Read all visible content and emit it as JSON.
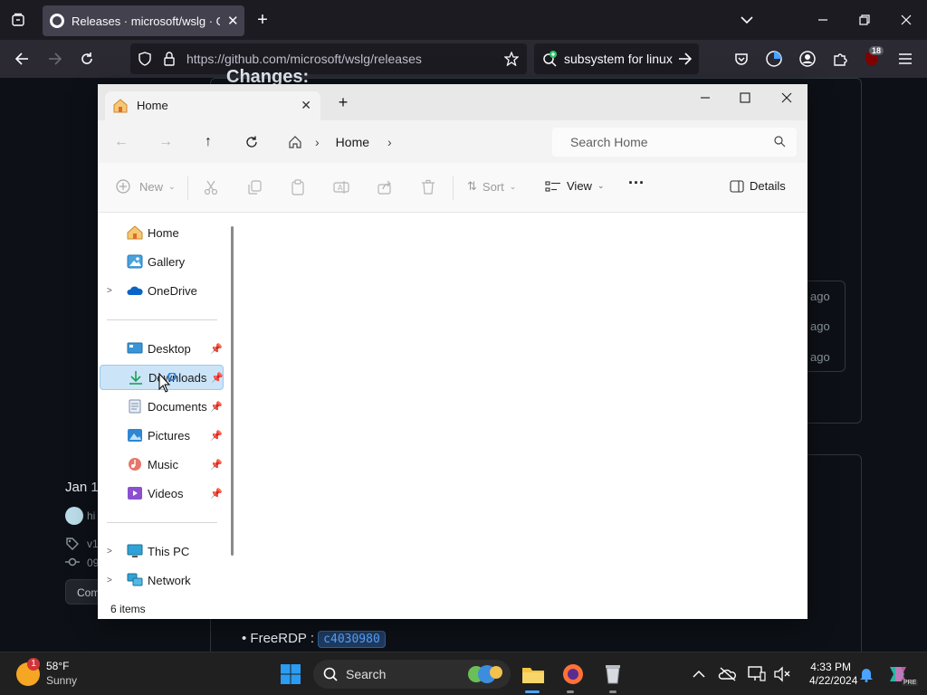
{
  "browser": {
    "tab_title": "Releases · microsoft/wslg · GitHub",
    "url": "https://github.com/microsoft/wslg/releases",
    "search_text": "subsystem for linux",
    "extension_badge": "18"
  },
  "github_page": {
    "heading": "Changes:",
    "ago_label": "ago",
    "release_date": "Jan 1",
    "author_fragment": "hi",
    "tag_fragment": "v1",
    "commit_fragment": "09",
    "button_fragment": "Com",
    "bullet_label": "FreeRDP :",
    "bullet_code": "c4030980"
  },
  "explorer": {
    "tab_title": "Home",
    "breadcrumb": "Home",
    "search_placeholder": "Search Home",
    "commands": {
      "new": "New",
      "sort": "Sort",
      "view": "View",
      "details": "Details"
    },
    "nav_items": [
      {
        "label": "Home",
        "icon": "home-icon",
        "pinned": false,
        "expandable": false
      },
      {
        "label": "Gallery",
        "icon": "gallery-icon",
        "pinned": false,
        "expandable": false
      },
      {
        "label": "OneDrive",
        "icon": "onedrive-icon",
        "pinned": false,
        "expandable": true
      },
      {
        "label": "Desktop",
        "icon": "desktop-icon",
        "pinned": true,
        "expandable": false
      },
      {
        "label": "Downloads",
        "icon": "downloads-icon",
        "pinned": true,
        "expandable": false
      },
      {
        "label": "Documents",
        "icon": "documents-icon",
        "pinned": true,
        "expandable": false
      },
      {
        "label": "Pictures",
        "icon": "pictures-icon",
        "pinned": true,
        "expandable": false
      },
      {
        "label": "Music",
        "icon": "music-icon",
        "pinned": true,
        "expandable": false
      },
      {
        "label": "Videos",
        "icon": "videos-icon",
        "pinned": true,
        "expandable": false
      },
      {
        "label": "This PC",
        "icon": "this-pc-icon",
        "pinned": false,
        "expandable": true
      },
      {
        "label": "Network",
        "icon": "network-icon",
        "pinned": false,
        "expandable": true
      }
    ],
    "selected_item": "Downloads",
    "status_text": "6 items"
  },
  "taskbar": {
    "weather_temp": "58°F",
    "weather_desc": "Sunny",
    "weather_badge": "1",
    "search_label": "Search",
    "time": "4:33 PM",
    "date": "4/22/2024",
    "copilot_badge": "PRE"
  },
  "colors": {
    "accent": "#0067c0",
    "selection_bg": "#cce4f7",
    "github_bg": "#0d1117",
    "firefox_toolbar": "#2b2a33"
  }
}
